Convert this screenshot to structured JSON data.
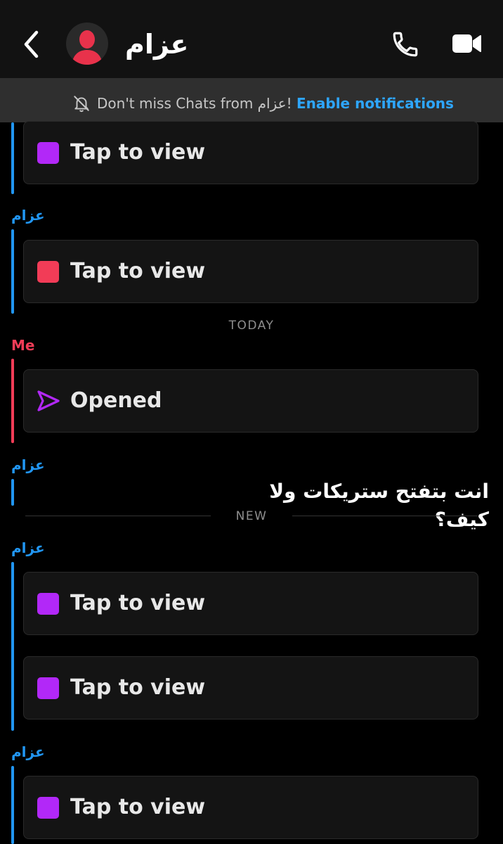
{
  "header": {
    "back_icon": "chevron-left-icon",
    "avatar_icon": "user-silhouette-icon",
    "contact_name": "عزام",
    "call_icon": "phone-icon",
    "video_icon": "video-camera-icon"
  },
  "banner": {
    "icon": "bell-off-icon",
    "text": "Don't miss Chats from عزام!",
    "link_label": "Enable notifications"
  },
  "colors": {
    "friend": "#2196f3",
    "me": "#f23c57",
    "snap_purple": "#b228f8",
    "snap_red": "#f23c57"
  },
  "chat": {
    "names": {
      "friend": "عزام",
      "me": "Me"
    },
    "tap_label": "Tap to view",
    "opened_label": "Opened",
    "today_divider": "TODAY",
    "new_divider": "NEW",
    "text_message": "انت بتفتح ستريكات ولا كيف؟"
  }
}
